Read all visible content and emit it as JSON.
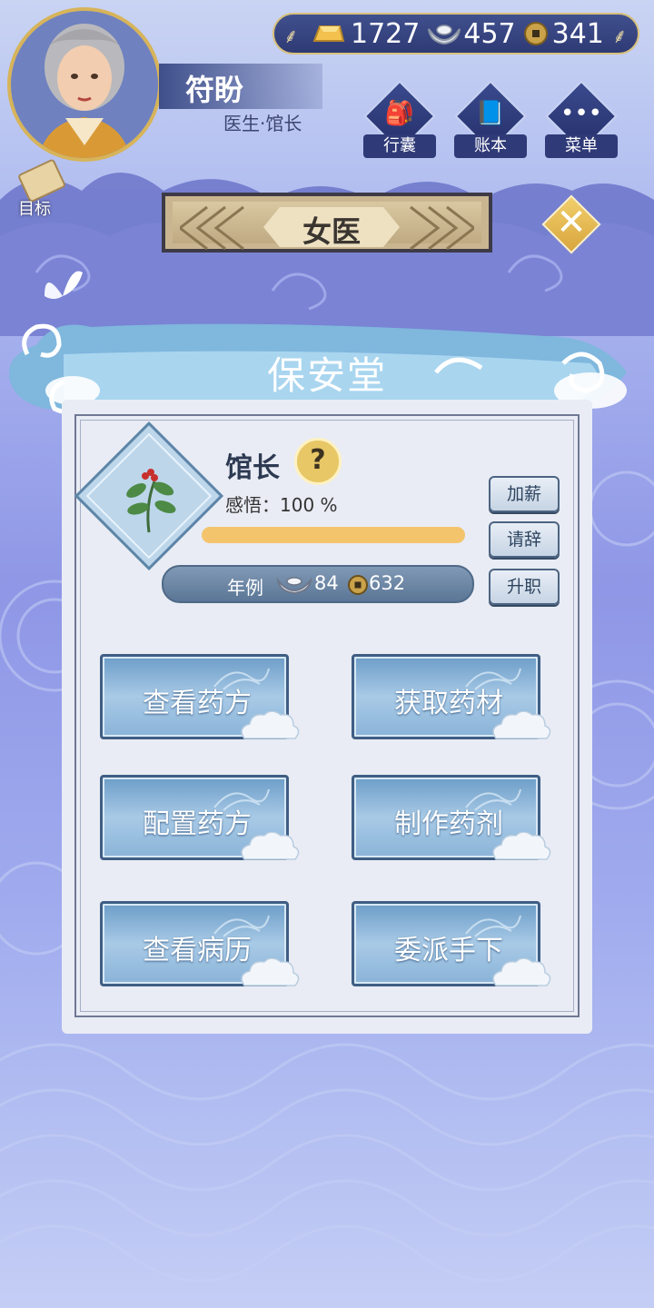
{
  "currency": {
    "gold": "1727",
    "silver": "457",
    "copper": "341",
    "gold_icon": "gold-ingot-icon",
    "silver_icon": "silver-ingot-icon",
    "copper_icon": "copper-coin-icon"
  },
  "player": {
    "name": "符盼",
    "title": "医生·馆长"
  },
  "top_buttons": {
    "bag": "行囊",
    "ledger": "账本",
    "menu": "菜单"
  },
  "goal": {
    "label": "目标"
  },
  "header": {
    "title": "女医"
  },
  "clinic": {
    "name": "保安堂"
  },
  "status": {
    "rank": "馆长",
    "help": "?",
    "insight": "感悟：100 %",
    "progress": 1.0
  },
  "salary": {
    "label": "年例",
    "silver": "84",
    "copper": "632"
  },
  "side_buttons": {
    "raise": "加薪",
    "resign": "请辞",
    "promote": "升职"
  },
  "actions": {
    "view_recipes": "查看药方",
    "get_herbs": "获取药材",
    "configure_recipe": "配置药方",
    "make_medicine": "制作药剂",
    "view_records": "查看病历",
    "assign_staff": "委派手下"
  },
  "colors": {
    "accent_gold": "#d7b45a",
    "panel_bg": "#e9ecf4",
    "button_blue": "#6d9dc8",
    "progress": "#f4c46d"
  }
}
